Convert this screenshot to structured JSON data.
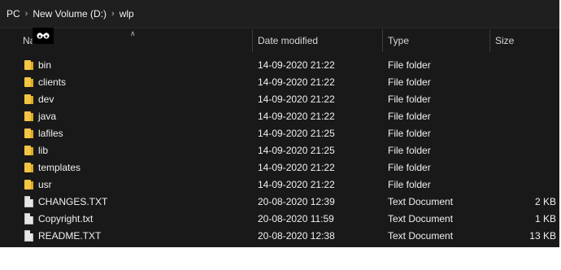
{
  "breadcrumb": [
    "PC",
    "New Volume (D:)",
    "wlp"
  ],
  "header": {
    "name": "Name",
    "date_modified": "Date modified",
    "type": "Type",
    "size": "Size"
  },
  "overlay_icon": "glasses-icon",
  "colors": {
    "background": "#191919",
    "folder": "#f4c542",
    "text": "#f0f0f0"
  },
  "rows": [
    {
      "icon": "folder-icon",
      "name": "bin",
      "date": "14-09-2020 21:22",
      "type": "File folder",
      "size": ""
    },
    {
      "icon": "folder-icon",
      "name": "clients",
      "date": "14-09-2020 21:22",
      "type": "File folder",
      "size": ""
    },
    {
      "icon": "folder-icon",
      "name": "dev",
      "date": "14-09-2020 21:22",
      "type": "File folder",
      "size": ""
    },
    {
      "icon": "folder-icon",
      "name": "java",
      "date": "14-09-2020 21:22",
      "type": "File folder",
      "size": ""
    },
    {
      "icon": "folder-icon",
      "name": "lafiles",
      "date": "14-09-2020 21:25",
      "type": "File folder",
      "size": ""
    },
    {
      "icon": "folder-icon",
      "name": "lib",
      "date": "14-09-2020 21:25",
      "type": "File folder",
      "size": ""
    },
    {
      "icon": "folder-icon",
      "name": "templates",
      "date": "14-09-2020 21:22",
      "type": "File folder",
      "size": ""
    },
    {
      "icon": "folder-icon",
      "name": "usr",
      "date": "14-09-2020 21:22",
      "type": "File folder",
      "size": ""
    },
    {
      "icon": "document-icon",
      "name": "CHANGES.TXT",
      "date": "20-08-2020 12:39",
      "type": "Text Document",
      "size": "2 KB"
    },
    {
      "icon": "document-icon",
      "name": "Copyright.txt",
      "date": "20-08-2020 11:59",
      "type": "Text Document",
      "size": "1 KB"
    },
    {
      "icon": "document-icon",
      "name": "README.TXT",
      "date": "20-08-2020 12:38",
      "type": "Text Document",
      "size": "13 KB"
    }
  ]
}
